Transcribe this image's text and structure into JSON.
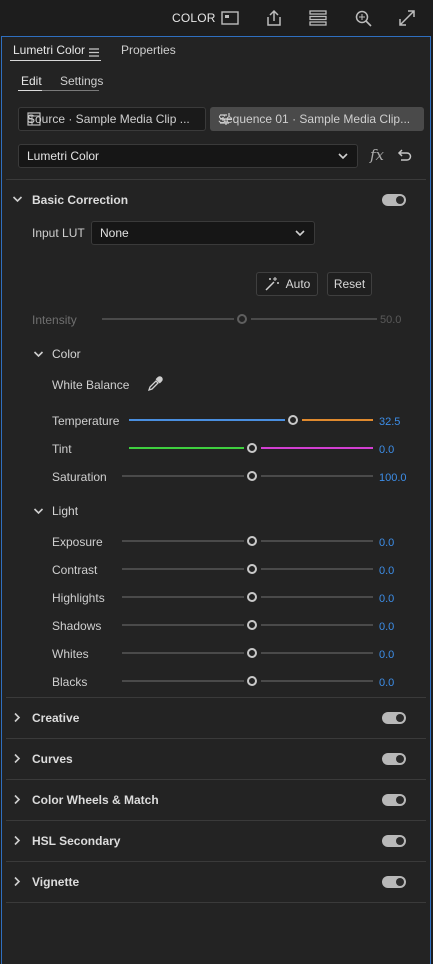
{
  "topbar": {
    "workspace": "COLOR"
  },
  "panel": {
    "tabs": [
      {
        "label": "Lumetri Color"
      },
      {
        "label": "Properties"
      }
    ],
    "subtabs": [
      {
        "label": "Edit"
      },
      {
        "label": "Settings"
      }
    ],
    "source_clip": "Source · Sample Media Clip ...",
    "sequence_clip": "Sequence 01 · Sample Media Clip...",
    "effect_dropdown": "Lumetri Color",
    "fx_label": "fx"
  },
  "basic_correction": {
    "title": "Basic Correction",
    "input_lut_label": "Input LUT",
    "input_lut_value": "None",
    "auto_label": "Auto",
    "reset_label": "Reset",
    "intensity": {
      "label": "Intensity",
      "value": "50.0"
    },
    "color": {
      "title": "Color",
      "white_balance_label": "White Balance",
      "temperature": {
        "label": "Temperature",
        "value": "32.5"
      },
      "tint": {
        "label": "Tint",
        "value": "0.0"
      },
      "saturation": {
        "label": "Saturation",
        "value": "100.0"
      }
    },
    "light": {
      "title": "Light",
      "exposure": {
        "label": "Exposure",
        "value": "0.0"
      },
      "contrast": {
        "label": "Contrast",
        "value": "0.0"
      },
      "highlights": {
        "label": "Highlights",
        "value": "0.0"
      },
      "shadows": {
        "label": "Shadows",
        "value": "0.0"
      },
      "whites": {
        "label": "Whites",
        "value": "0.0"
      },
      "blacks": {
        "label": "Blacks",
        "value": "0.0"
      }
    }
  },
  "sections": [
    {
      "title": "Creative"
    },
    {
      "title": "Curves"
    },
    {
      "title": "Color Wheels & Match"
    },
    {
      "title": "HSL Secondary"
    },
    {
      "title": "Vignette"
    }
  ],
  "colors": {
    "accent_value": "#3d8ee8",
    "panel_border": "#2f6fbf",
    "temperature_cool": "#4a8fe0",
    "temperature_warm": "#e08a2e",
    "tint_green": "#3fcf3f",
    "tint_magenta": "#d23fd2"
  },
  "icons": [
    "layout-icon",
    "share-icon",
    "panels-icon",
    "search-icon",
    "fullscreen-icon",
    "hamburger-menu-icon",
    "clip-icon",
    "sequence-icon",
    "chevron-down-icon",
    "reset-arrow-icon",
    "magic-wand-icon",
    "eyedropper-icon",
    "chevron-right-icon"
  ]
}
